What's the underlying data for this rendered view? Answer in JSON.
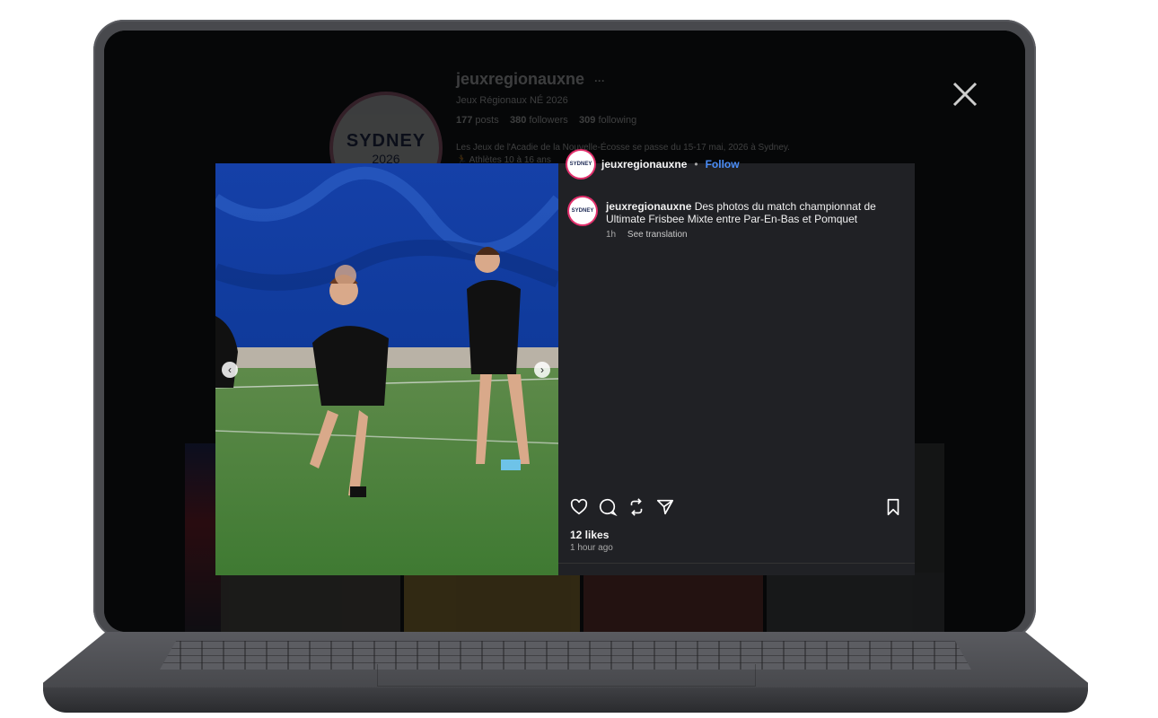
{
  "profile": {
    "username": "jeuxregionauxne",
    "more": "···",
    "display_name": "Jeux Régionaux NÉ 2026",
    "stats": {
      "posts_count": "177",
      "posts_label": "posts",
      "followers_count": "380",
      "followers_label": "followers",
      "following_count": "309",
      "following_label": "following"
    },
    "bio_line1": "Les Jeux de l'Acadie de la Nouvelle-Écosse se passe du 15-17 mai, 2026 à Sydney.",
    "bio_line2": "🏃 Athlètes 10 à 16 ans",
    "avatar_logo": "SYDNEY",
    "avatar_year": "2026"
  },
  "modal": {
    "header": {
      "username": "jeuxregionauxne",
      "separator": "•",
      "follow_label": "Follow"
    },
    "caption": {
      "username": "jeuxregionauxne",
      "text": "Des photos du match championnat de Ultimate Frisbee Mixte entre Par-En-Bas et Pomquet",
      "time": "1h",
      "translate_label": "See translation"
    },
    "avatar_text": "SYDNEY",
    "likes": "12 likes",
    "posted_ago": "1 hour ago",
    "icons": {
      "like": "heart-icon",
      "comment": "comment-icon",
      "share": "repost-icon",
      "send": "send-icon",
      "save": "bookmark-icon",
      "prev": "chevron-left-icon",
      "next": "chevron-right-icon",
      "close": "close-icon"
    }
  },
  "colors": {
    "panel_bg": "#202125",
    "follow": "#4a8df8",
    "avatar_ring": "#e1306c"
  }
}
